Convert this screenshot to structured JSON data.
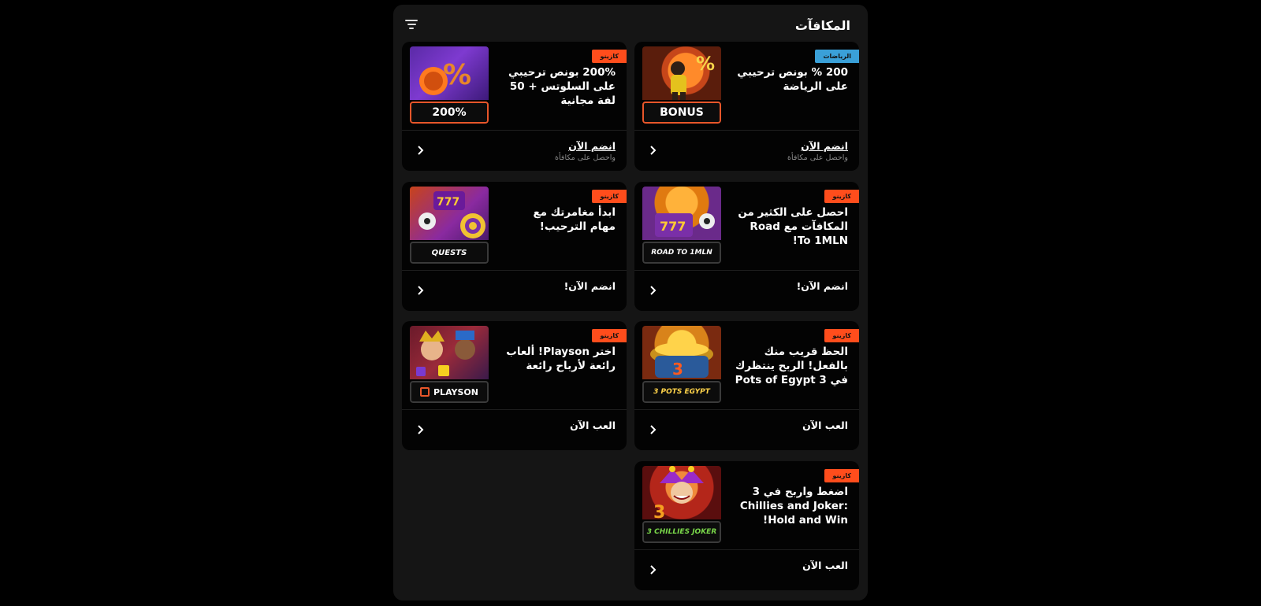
{
  "header": {
    "title": "المكافآت",
    "filter_icon": "filter-icon"
  },
  "colors": {
    "casino_badge": "#ff4d1c",
    "sports_badge": "#3aa0d8",
    "card_bg": "#030303",
    "panel_bg": "#151515"
  },
  "cards": [
    {
      "badge": "الرياضات",
      "badge_type": "sports",
      "title": "200 % بونص ترحيبي على الرياضة",
      "thumb_label": "BONUS",
      "cta": "انضم الآن",
      "cta_sub": "واحصل على مكافأة"
    },
    {
      "badge": "كازينو",
      "badge_type": "casino",
      "title": "200% بونص ترحيبي على السلوتس + 50 لفة مجانية",
      "thumb_label": "200%",
      "cta": "انضم الآن",
      "cta_sub": "واحصل على مكافأة"
    },
    {
      "badge": "كازينو",
      "badge_type": "casino",
      "title": "احصل على الكثير من المكافآت مع Road To 1MLN!",
      "thumb_label": "ROAD TO 1MLN",
      "cta": "انضم الآن!",
      "cta_sub": ""
    },
    {
      "badge": "كازينو",
      "badge_type": "casino",
      "title": "ابدأ مغامرتك مع مهام الترحيب!",
      "thumb_label": "QUESTS",
      "cta": "انضم الآن!",
      "cta_sub": ""
    },
    {
      "badge": "كازينو",
      "badge_type": "casino",
      "title": "الحظ قريب منك بالفعل! الربح ينتظرك في 3 Pots of Egypt",
      "thumb_label": "3 POTS EGYPT",
      "cta": "العب الآن",
      "cta_sub": ""
    },
    {
      "badge": "كازينو",
      "badge_type": "casino",
      "title": "اختر Playson! ألعاب رائعة لأرباح رائعة",
      "thumb_label": "PLAYSON",
      "cta": "العب الآن",
      "cta_sub": ""
    },
    {
      "badge": "كازينو",
      "badge_type": "casino",
      "title": "اضغط واربح في 3 Chillies and Joker: Hold and Win!",
      "thumb_label": "3 CHILLIES JOKER",
      "cta": "العب الآن",
      "cta_sub": ""
    }
  ]
}
